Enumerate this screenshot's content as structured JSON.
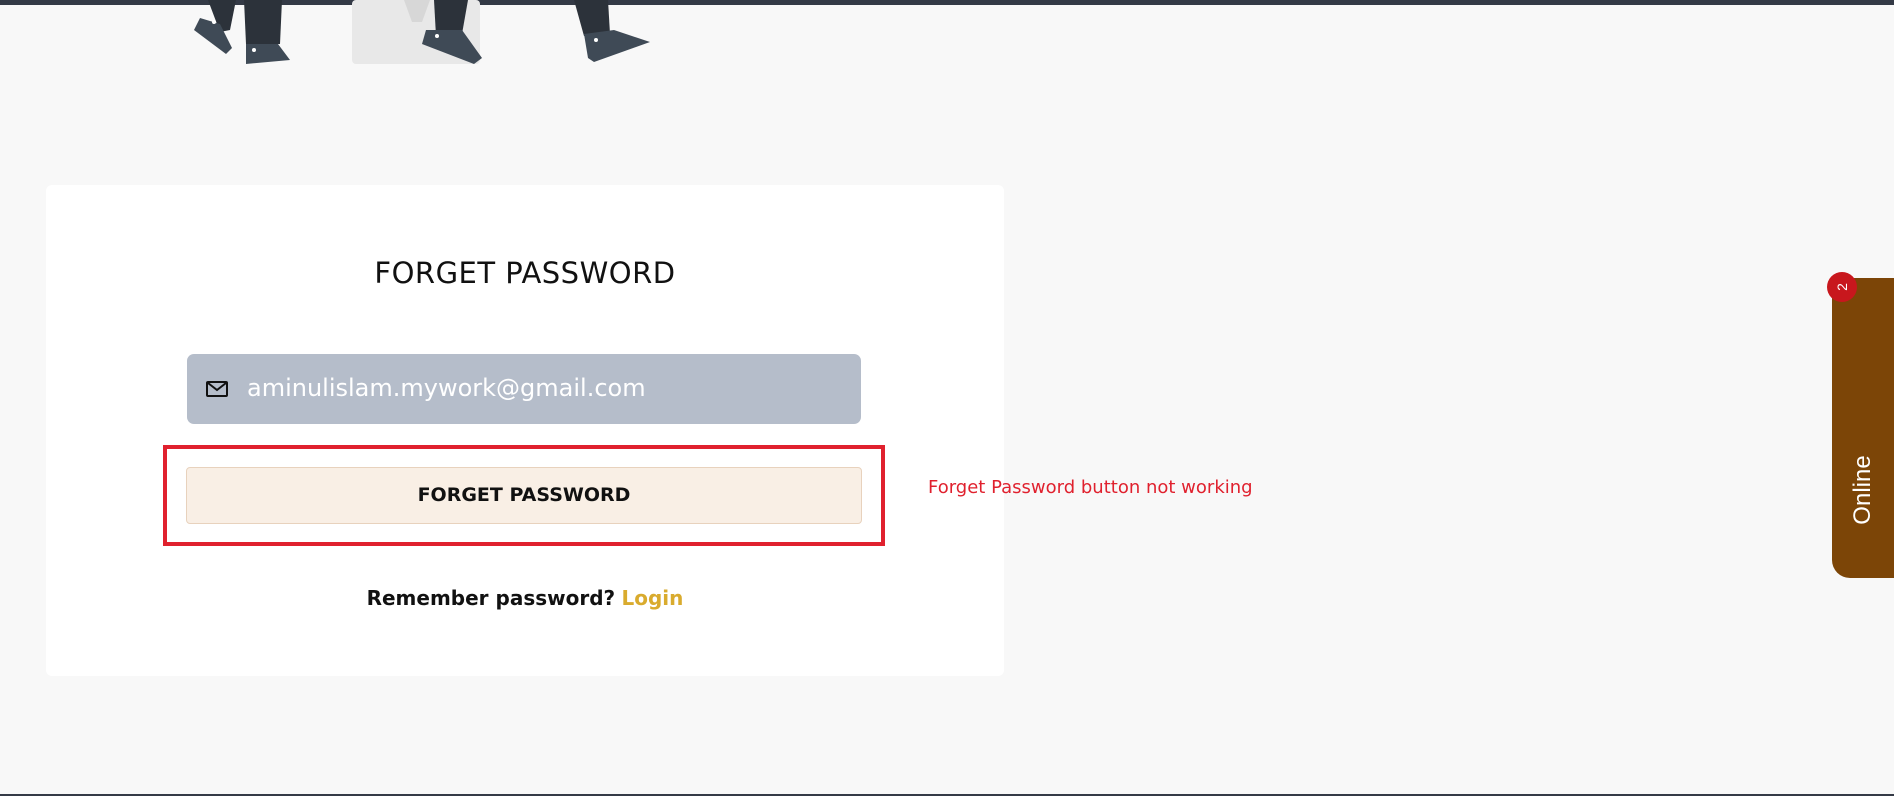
{
  "form": {
    "title": "FORGET PASSWORD",
    "email_value": "aminulislam.mywork@gmail.com",
    "email_icon": "mail-icon",
    "submit_label": "FORGET PASSWORD",
    "remember_text": "Remember password?",
    "login_label": "Login"
  },
  "annotation": {
    "text": "Forget Password button not working",
    "color": "#e0212e"
  },
  "chat_widget": {
    "label": "Online",
    "badge_count": "2",
    "color": "#7c4507"
  },
  "colors": {
    "accent_link": "#d9ab2e",
    "input_bg": "#b5bdca",
    "button_bg": "#f9efe5",
    "badge": "#c8171d"
  }
}
